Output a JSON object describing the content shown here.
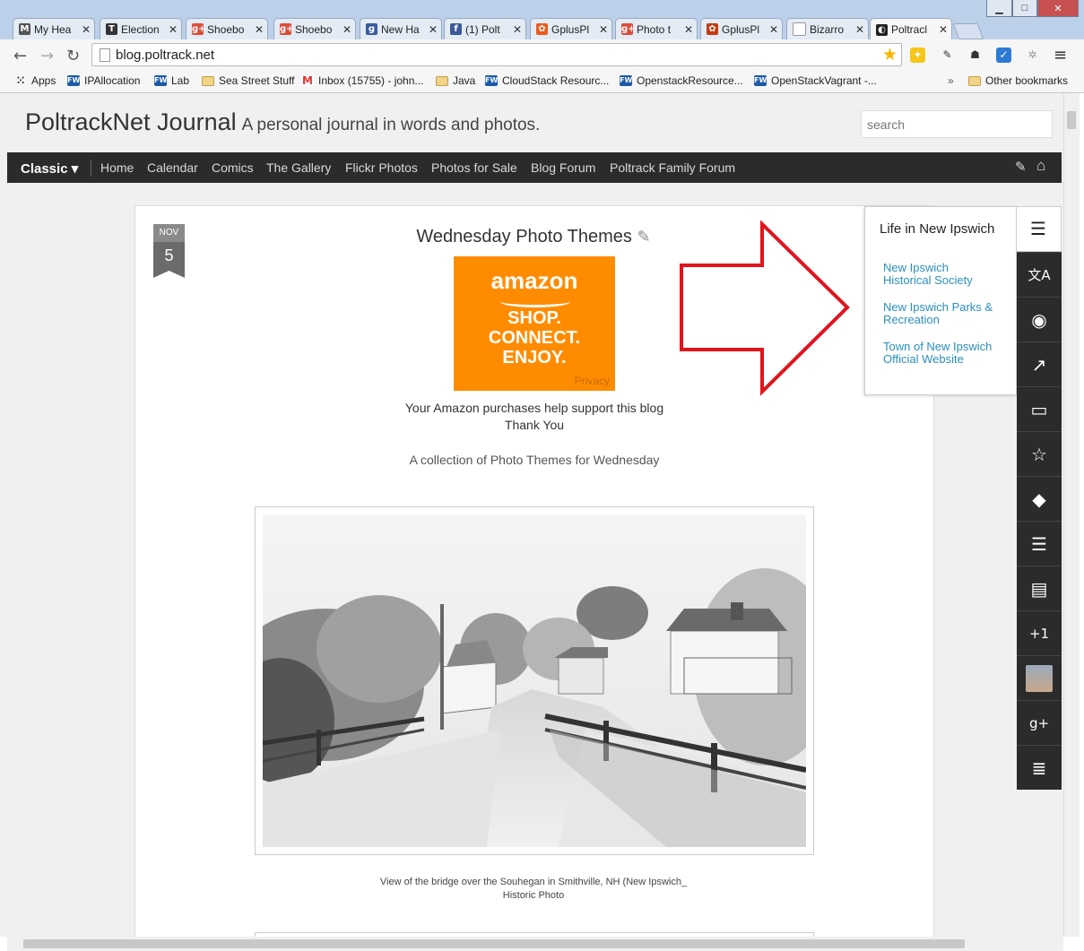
{
  "browser": {
    "tabs": [
      {
        "title": "My Hea",
        "favicon_color": "#555555",
        "favicon_text": "M"
      },
      {
        "title": "Election",
        "favicon_color": "#333333",
        "favicon_text": "T"
      },
      {
        "title": "Shoebo",
        "favicon_color": "#dd4b39",
        "favicon_text": "g+"
      },
      {
        "title": "Shoebo",
        "favicon_color": "#dd4b39",
        "favicon_text": "g+"
      },
      {
        "title": "New Ha",
        "favicon_color": "#3a5b9e",
        "favicon_text": "g"
      },
      {
        "title": "(1) Polt",
        "favicon_color": "#3b5998",
        "favicon_text": "f"
      },
      {
        "title": "GplusPl",
        "favicon_color": "#e85c1e",
        "favicon_text": "✿"
      },
      {
        "title": "Photo t",
        "favicon_color": "#dd4b39",
        "favicon_text": "g+"
      },
      {
        "title": "GplusPl",
        "favicon_color": "#c33a10",
        "favicon_text": "✿"
      },
      {
        "title": "Bizarro",
        "favicon_color": "#ffffff",
        "favicon_text": ""
      },
      {
        "title": "Poltracl",
        "favicon_color": "#222222",
        "favicon_text": "◐",
        "active": true
      }
    ],
    "window_buttons": {
      "minimize": "▁",
      "maximize": "□",
      "close": "✕"
    },
    "nav": {
      "back": "←",
      "forward": "→",
      "reload": "↻"
    },
    "url": "blog.poltrack.net",
    "star": "★",
    "menu_icon": "≡",
    "bookmarks": [
      {
        "label": "Apps",
        "icon": "apps"
      },
      {
        "label": "IPAllocation",
        "icon": "fw"
      },
      {
        "label": "Lab",
        "icon": "fw"
      },
      {
        "label": "Sea Street Stuff",
        "icon": "folder"
      },
      {
        "label": "Inbox (15755) - john...",
        "icon": "gmail"
      },
      {
        "label": "Java",
        "icon": "folder"
      },
      {
        "label": "CloudStack Resourc...",
        "icon": "fw"
      },
      {
        "label": "OpenstackResource...",
        "icon": "fw"
      },
      {
        "label": "OpenStackVagrant -...",
        "icon": "fw"
      }
    ],
    "bookmarks_overflow": "»",
    "other_bookmarks": "Other bookmarks",
    "fw_icon_text": "FW",
    "gmail_icon_text": "M"
  },
  "site": {
    "title": "PoltrackNet Journal",
    "tagline": "A personal journal in words and photos.",
    "search_placeholder": "search",
    "nav": {
      "view_selector": "Classic ▾",
      "links": [
        "Home",
        "Calendar",
        "Comics",
        "The Gallery",
        "Flickr Photos",
        "Photos for Sale",
        "Blog Forum",
        "Poltrack Family Forum"
      ],
      "edit_icon": "✎",
      "home_icon": "⌂"
    }
  },
  "post": {
    "date_month": "NOV",
    "date_day": "5",
    "title": "Wednesday Photo Themes",
    "edit_icon": "✎",
    "ad": {
      "logo": "amazon",
      "lines": [
        "SHOP.",
        "CONNECT.",
        "ENJOY."
      ],
      "privacy": "Privacy"
    },
    "support_line1": "Your Amazon purchases help support this blog",
    "support_line2": "Thank You",
    "intro": "A collection of Photo Themes for Wednesday",
    "caption_line1": "View of the bridge over the Souhegan in Smithville, NH (New Ipswich_",
    "caption_line2": "Historic Photo"
  },
  "widget": {
    "title": "Life in New Ipswich",
    "links": [
      "New Ipswich Historical Society",
      "New Ipswich Parks & Recreation",
      "Town of New Ipswich Official Website"
    ],
    "list_icon": "☰"
  },
  "sidebar_icons": [
    {
      "name": "translate-icon",
      "glyph": "文A"
    },
    {
      "name": "rss-icon",
      "glyph": "◉"
    },
    {
      "name": "stats-icon",
      "glyph": "↗"
    },
    {
      "name": "photos-icon",
      "glyph": "▭"
    },
    {
      "name": "featured-icon",
      "glyph": "☆"
    },
    {
      "name": "tags-icon",
      "glyph": "◆"
    },
    {
      "name": "list-icon",
      "glyph": "☰"
    },
    {
      "name": "archive-icon",
      "glyph": "▤"
    },
    {
      "name": "plus-one-icon",
      "glyph": "+1"
    },
    {
      "name": "avatar",
      "glyph": ""
    },
    {
      "name": "google-plus-icon",
      "glyph": "g+"
    },
    {
      "name": "quote-list-icon",
      "glyph": "≣"
    }
  ],
  "colors": {
    "tab_strip": "#bcd0ea",
    "navbar": "#2b2b2b",
    "link": "#2a8fbd",
    "amazon_orange": "#ff8c00",
    "arrow_red": "#e0141e"
  }
}
